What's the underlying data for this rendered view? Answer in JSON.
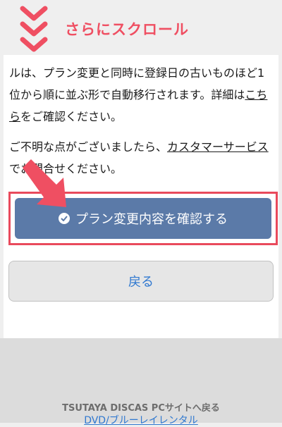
{
  "header": {
    "scroll_label": "さらにスクロール"
  },
  "content": {
    "para1_a": "ルは、プラン変更と同時に登録日の古いものほど1位から順に並ぶ形で自動移行されます。詳細は",
    "para1_link": "こちら",
    "para1_b": "をご確認ください。",
    "para2_a": "ご不明な点がございましたら、",
    "para2_link": "カスタマーサービス",
    "para2_b": "でお問合せください。"
  },
  "buttons": {
    "confirm_label": "プラン変更内容を確認する",
    "back_label": "戻る"
  },
  "footer": {
    "pc_site_link": "TSUTAYA DISCAS PCサイトへ戻る",
    "dvd_link": "DVD/ブルーレイレンタル"
  },
  "colors": {
    "accent_red": "#ef4f62",
    "primary_button": "#5b7aa8",
    "link_blue": "#2f78d0"
  },
  "icons": {
    "scroll_hint": "triple-chevron-down-icon",
    "pointer": "pointer-arrow-icon",
    "confirm": "check-circle-icon"
  }
}
